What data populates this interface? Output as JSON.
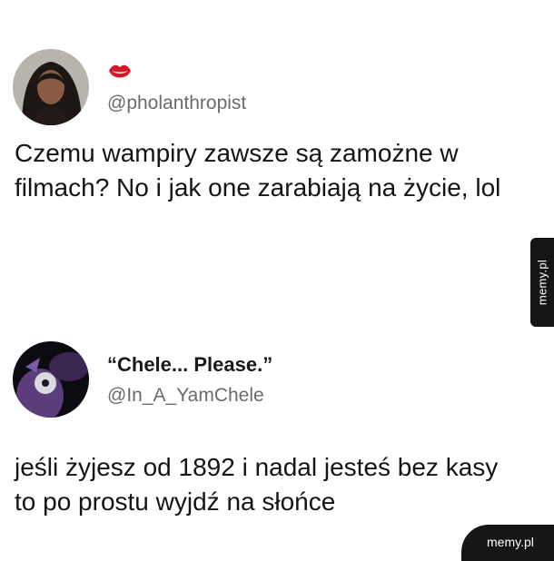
{
  "tweets": [
    {
      "handle": "@pholanthropist",
      "text": "Czemu wampiry zawsze są zamożne w filmach? No i jak one zarabiają na życie, lol"
    },
    {
      "display_name": "“Chele... Please.”",
      "handle": "@In_A_YamChele",
      "text": "jeśli żyjesz od 1892 i nadal jesteś bez kasy to po prostu wyjdź na słońce"
    }
  ],
  "watermark": {
    "side_label": "memy.pl",
    "corner_label": "memy.pl"
  },
  "colors": {
    "background": "#ffffff",
    "text": "#151515",
    "handle": "#6b6b6b",
    "badge": "#161616",
    "lips_icon": "#d11a2a"
  }
}
